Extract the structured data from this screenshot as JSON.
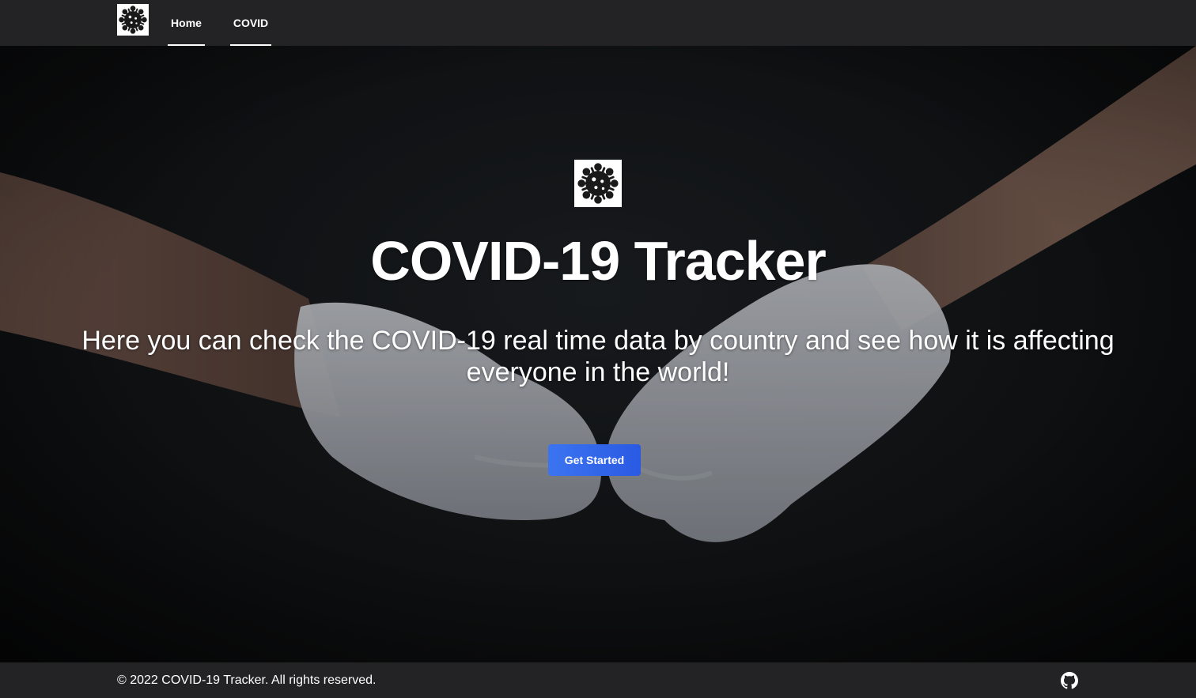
{
  "navbar": {
    "logo_icon": "virus-icon",
    "links": [
      {
        "label": "Home"
      },
      {
        "label": "COVID"
      }
    ]
  },
  "hero": {
    "logo_icon": "virus-icon",
    "title": "COVID-19 Tracker",
    "subtitle": "Here you can check the COVID-19 real time data by country and see how it is affecting everyone in the world!",
    "cta_label": "Get Started",
    "background_image": "two gloved fists bumping on dark background"
  },
  "footer": {
    "copyright": "© 2022 COVID-19 Tracker. All rights reserved.",
    "social_icon": "github-icon"
  },
  "colors": {
    "navbar_bg": "#232325",
    "footer_bg": "#232325",
    "button_blue": "#2f63e8",
    "text": "#ffffff"
  }
}
